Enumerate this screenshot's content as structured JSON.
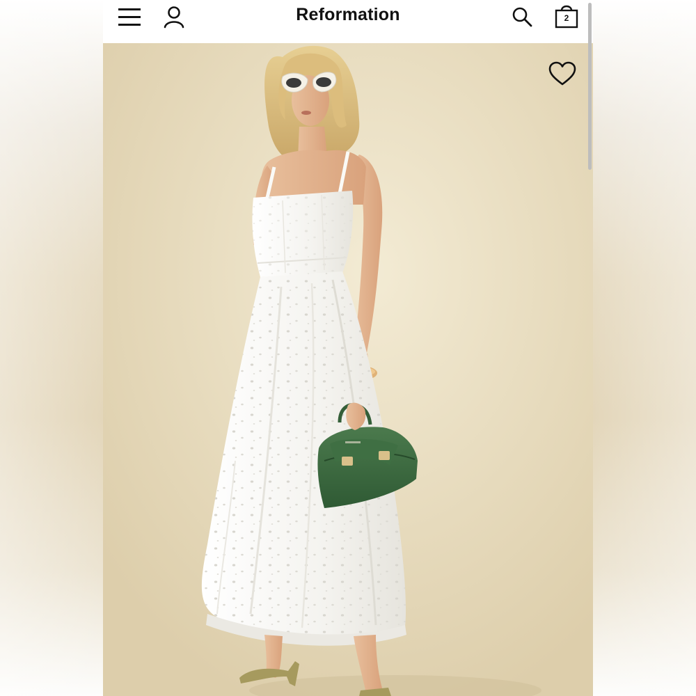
{
  "header": {
    "brand": "Reformation",
    "icons": {
      "menu": "hamburger-menu-icon",
      "account": "account-icon",
      "search": "search-icon",
      "bag": "shopping-bag-icon"
    },
    "bag_count": "2"
  },
  "product": {
    "image_description_icon": "product-photo",
    "favorite_icon": "heart-outline-icon"
  },
  "colors": {
    "background": "#e8dcc0",
    "dress": "#f7f6f2",
    "bag": "#3d6a41",
    "text": "#111111"
  }
}
